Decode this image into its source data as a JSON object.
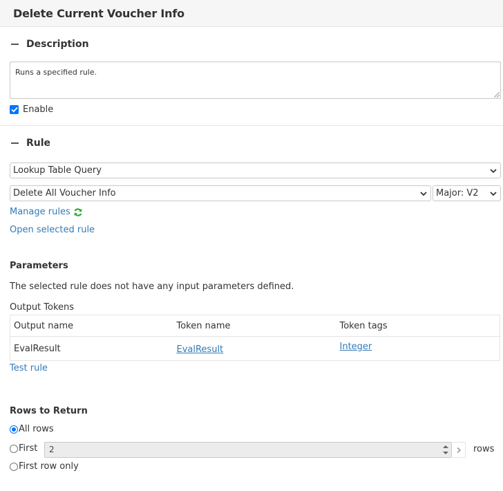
{
  "header": {
    "title": "Delete Current Voucher Info"
  },
  "description_section": {
    "label": "Description",
    "text": "Runs a specified rule.",
    "enable_label": "Enable",
    "enabled": true
  },
  "rule_section": {
    "label": "Rule",
    "rule_type": "Lookup Table Query",
    "rule_name": "Delete All Voucher Info",
    "version": "Major: V2",
    "manage_rules": "Manage rules",
    "open_selected_rule": "Open selected rule",
    "parameters_label": "Parameters",
    "parameters_text": "The selected rule does not have any input parameters defined.",
    "output_tokens_label": "Output Tokens",
    "columns": [
      "Output name",
      "Token name",
      "Token tags"
    ],
    "rows": [
      {
        "output_name": "EvalResult",
        "token_name": "EvalResult",
        "token_tags": "Integer"
      }
    ],
    "test_rule": "Test rule"
  },
  "rows_to_return": {
    "label": "Rows to Return",
    "all_rows": "All rows",
    "first": "First",
    "first_value": "2",
    "rows_suffix": "rows",
    "first_row_only": "First row only",
    "selected": "all_rows"
  },
  "colors": {
    "link": "#337ab7",
    "accent": "#0075ff",
    "refresh": "#2eaa2e"
  },
  "icons": [
    "collapse-icon",
    "refresh-icon",
    "chevron-down-icon",
    "chevron-right-icon",
    "checkmark-icon"
  ]
}
